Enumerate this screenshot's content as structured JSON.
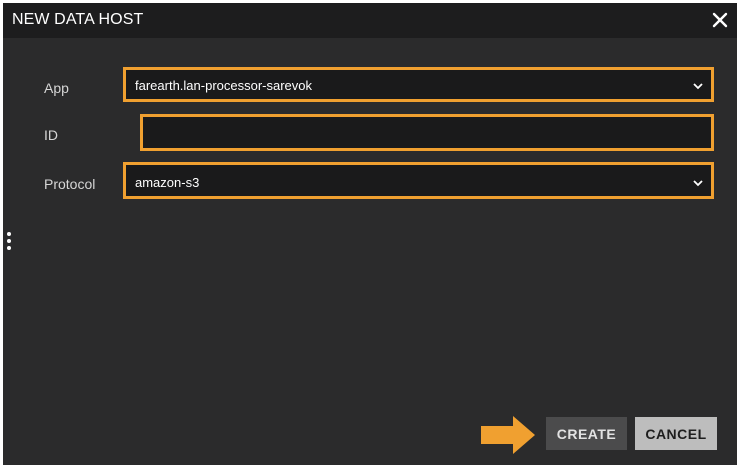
{
  "dialog": {
    "title": "NEW DATA HOST",
    "close_icon": "close-icon"
  },
  "form": {
    "app_label": "App",
    "app_value": "farearth.lan-processor-sarevok",
    "id_label": "ID",
    "id_value": "",
    "protocol_label": "Protocol",
    "protocol_value": "amazon-s3"
  },
  "buttons": {
    "create_label": "CREATE",
    "cancel_label": "CANCEL"
  },
  "annotations": {
    "highlight_color": "#f0a030",
    "arrow_icon": "arrow-right-icon"
  },
  "colors": {
    "dialog_bg": "#2b2b2c",
    "titlebar_bg": "#1d1d1e",
    "field_bg": "#1a1a1b"
  }
}
